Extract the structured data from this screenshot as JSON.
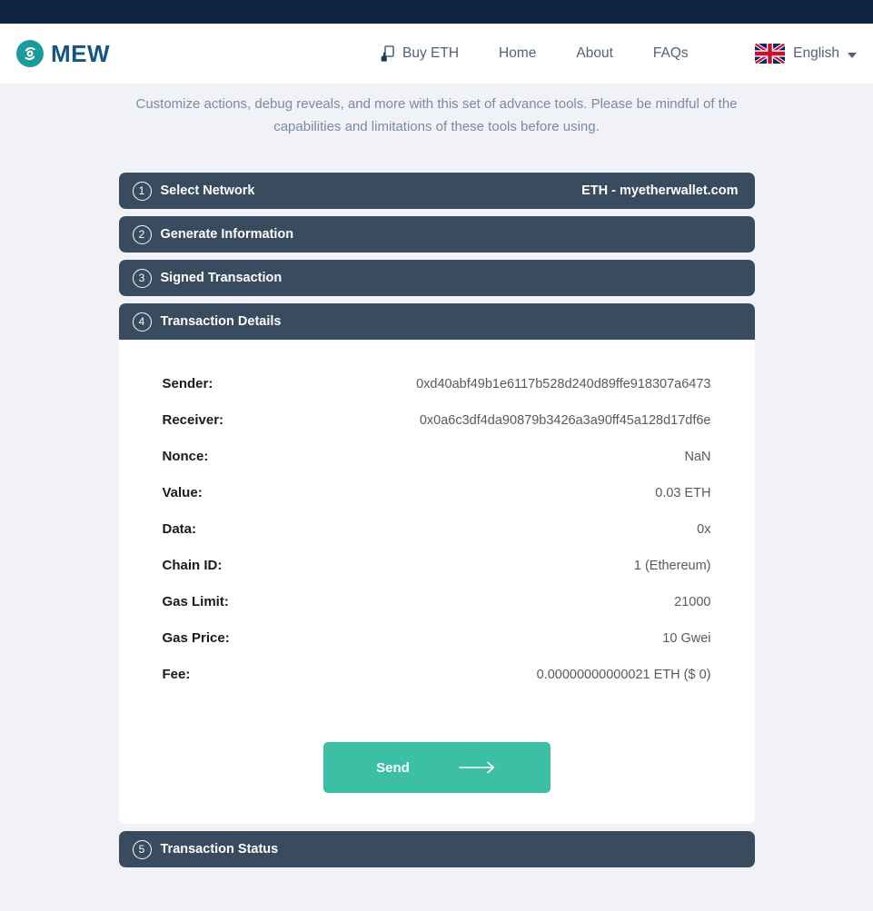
{
  "header": {
    "logo_text": "MEW",
    "logo_icon": "mew-circle-icon",
    "nav": [
      {
        "label": "Buy ETH",
        "icon": "credit-card-icon"
      },
      {
        "label": "Home",
        "icon": ""
      },
      {
        "label": "About",
        "icon": ""
      },
      {
        "label": "FAQs",
        "icon": ""
      }
    ],
    "language": {
      "label": "English",
      "flag_icon": "uk-flag-icon",
      "chevron_icon": "chevron-down-icon"
    }
  },
  "intro": "Customize actions, debug reveals, and more with this set of advance tools. Please be mindful of the capabilities and limitations of these tools before using.",
  "steps": [
    {
      "number": "1",
      "title": "Select Network",
      "right": "ETH - myetherwallet.com",
      "open": false
    },
    {
      "number": "2",
      "title": "Generate Information",
      "right": "",
      "open": false
    },
    {
      "number": "3",
      "title": "Signed Transaction",
      "right": "",
      "open": false
    },
    {
      "number": "4",
      "title": "Transaction Details",
      "right": "",
      "open": true
    },
    {
      "number": "5",
      "title": "Transaction Status",
      "right": "",
      "open": false
    }
  ],
  "transaction_details": {
    "rows": [
      {
        "label": "Sender:",
        "value": "0xd40abf49b1e6117b528d240d89ffe918307a6473"
      },
      {
        "label": "Receiver:",
        "value": "0x0a6c3df4da90879b3426a3a90ff45a128d17df6e"
      },
      {
        "label": "Nonce:",
        "value": "NaN"
      },
      {
        "label": "Value:",
        "value": "0.03 ETH"
      },
      {
        "label": "Data:",
        "value": "0x"
      },
      {
        "label": "Chain ID:",
        "value": "1 (Ethereum)"
      },
      {
        "label": "Gas Limit:",
        "value": "21000"
      },
      {
        "label": "Gas Price:",
        "value": "10 Gwei"
      },
      {
        "label": "Fee:",
        "value": "0.00000000000021 ETH ($ 0)"
      }
    ],
    "send_button": {
      "label": "Send",
      "icon": "arrow-right-icon"
    }
  },
  "colors": {
    "top_strip": "#0d2440",
    "page_background": "#f0f2f7",
    "step_header": "#394b5f",
    "accent_teal": "#3dbfa5",
    "logo_teal": "#1d9a9a",
    "logo_navy": "#16557f"
  }
}
